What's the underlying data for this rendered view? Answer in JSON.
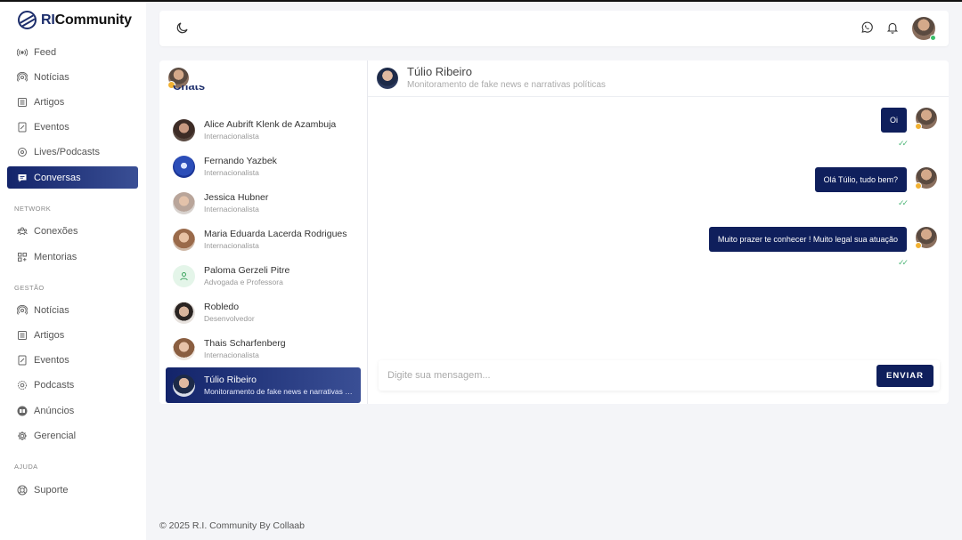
{
  "app": {
    "logo_prefix": "RI",
    "logo_suffix": "Community"
  },
  "sidebar": {
    "items": [
      {
        "label": "Feed",
        "icon": "broadcast-icon"
      },
      {
        "label": "Notícias",
        "icon": "podcast-icon"
      },
      {
        "label": "Artigos",
        "icon": "document-lines-icon"
      },
      {
        "label": "Eventos",
        "icon": "calendar-doc-icon"
      },
      {
        "label": "Lives/Podcasts",
        "icon": "live-icon"
      },
      {
        "label": "Conversas",
        "icon": "chat-bubble-icon",
        "active": true
      }
    ],
    "network_label": "NETWORK",
    "network_items": [
      {
        "label": "Conexões",
        "icon": "people-icon"
      },
      {
        "label": "Mentorias",
        "icon": "grid-icon"
      }
    ],
    "gestao_label": "GESTÃO",
    "gestao_items": [
      {
        "label": "Notícias",
        "icon": "podcast-icon"
      },
      {
        "label": "Artigos",
        "icon": "document-lines-icon"
      },
      {
        "label": "Eventos",
        "icon": "calendar-doc-icon"
      },
      {
        "label": "Podcasts",
        "icon": "live-icon"
      },
      {
        "label": "Anúncios",
        "icon": "ads-icon"
      },
      {
        "label": "Gerencial",
        "icon": "gear-icon"
      }
    ],
    "ajuda_label": "AJUDA",
    "ajuda_items": [
      {
        "label": "Suporte",
        "icon": "lifebuoy-icon"
      }
    ]
  },
  "chats": {
    "title": "Chats",
    "contacts": [
      {
        "name": "Alice Aubrift Klenk de Azambuja",
        "role": "Internacionalista"
      },
      {
        "name": "Fernando Yazbek",
        "role": "Internacionalista"
      },
      {
        "name": "Jessica Hubner",
        "role": "Internacionalista"
      },
      {
        "name": "Maria Eduarda Lacerda Rodrigues",
        "role": "Internacionalista"
      },
      {
        "name": "Paloma Gerzeli Pitre",
        "role": "Advogada e Professora"
      },
      {
        "name": "Robledo",
        "role": "Desenvolvedor"
      },
      {
        "name": "Thais Scharfenberg",
        "role": "Internacionalista"
      },
      {
        "name": "Túlio Ribeiro",
        "role": "Monitoramento de fake news e narrativas políticas",
        "active": true
      }
    ]
  },
  "conversation": {
    "name": "Túlio Ribeiro",
    "subtitle": "Monitoramento de fake news e narrativas políticas",
    "messages": [
      {
        "text": "Oi",
        "status": "read"
      },
      {
        "text": "Olá Túlio, tudo bem?",
        "status": "read"
      },
      {
        "text": "Muito prazer te conhecer ! Muito legal sua atuação",
        "status": "read"
      }
    ],
    "composer": {
      "placeholder": "Digite sua mensagem...",
      "send_label": "ENVIAR"
    }
  },
  "footer": {
    "text": "© 2025 R.I. Community By Collaab"
  },
  "colors": {
    "primary": "#0f1f5c",
    "accent_gradient_end": "#3a4f95",
    "online": "#3bbf6a",
    "read_check": "#4fb779"
  }
}
